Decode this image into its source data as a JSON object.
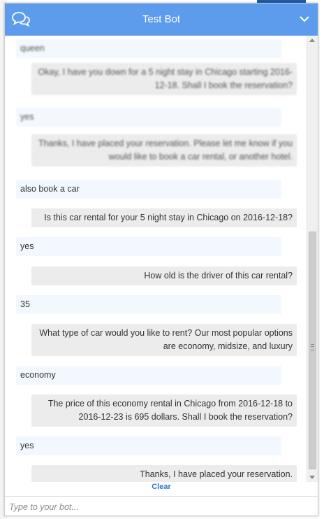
{
  "header": {
    "title": "Test Bot"
  },
  "messages": [
    {
      "from": "user",
      "text": "queen"
    },
    {
      "from": "bot",
      "text": "Okay, I have you down for a 5 night stay in Chicago starting 2016-12-18. Shall I book the reservation?"
    },
    {
      "from": "user",
      "text": "yes"
    },
    {
      "from": "bot",
      "text": "Thanks, I have placed your reservation. Please let me know if you would like to book a car rental, or another hotel."
    },
    {
      "from": "user",
      "text": "also book a car"
    },
    {
      "from": "bot",
      "text": "Is this car rental for your 5 night stay in Chicago on 2016-12-18?"
    },
    {
      "from": "user",
      "text": "yes"
    },
    {
      "from": "bot",
      "text": "How old is the driver of this car rental?"
    },
    {
      "from": "user",
      "text": "35"
    },
    {
      "from": "bot",
      "text": "What type of car would you like to rent? Our most popular options are economy, midsize, and luxury"
    },
    {
      "from": "user",
      "text": "economy"
    },
    {
      "from": "bot",
      "text": "The price of this economy rental in Chicago from 2016-12-18 to 2016-12-23 is 695 dollars. Shall I book the reservation?"
    },
    {
      "from": "user",
      "text": "yes"
    },
    {
      "from": "bot",
      "text": "Thanks, I have placed your reservation."
    }
  ],
  "controls": {
    "clear_label": "Clear",
    "input_placeholder": "Type to your bot..."
  },
  "colors": {
    "header_bg": "#5d9cec",
    "user_bubble": "#f2f8fe",
    "bot_bubble": "#ececec",
    "link": "#2b75c8"
  },
  "icons": {
    "header_left": "chat-bubbles-icon",
    "header_right": "chevron-down-icon"
  }
}
